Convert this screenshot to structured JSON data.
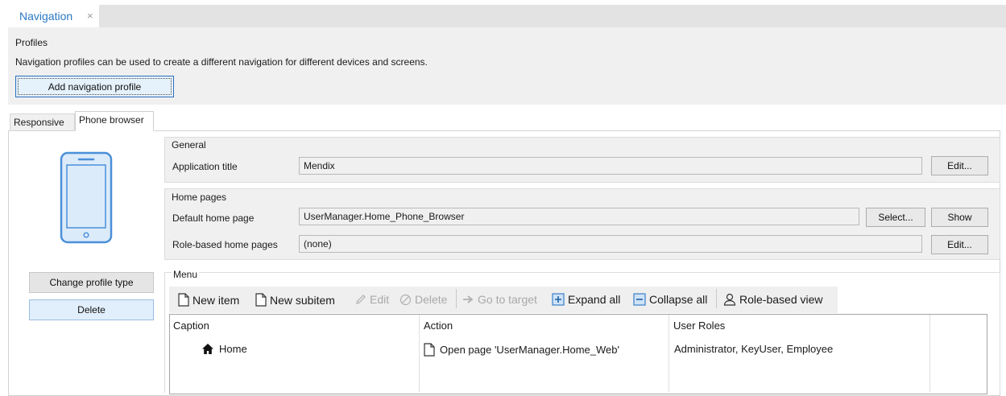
{
  "document_tab": {
    "title": "Navigation",
    "close": "×"
  },
  "profiles": {
    "title": "Profiles",
    "description": "Navigation profiles can be used to create a different navigation for different devices and screens.",
    "add_button": "Add navigation profile"
  },
  "profile_tabs": [
    {
      "label": "Responsive",
      "active": false
    },
    {
      "label": "Phone browser",
      "active": true
    }
  ],
  "left_pane": {
    "icon": "phone-icon",
    "change_type_button": "Change profile type",
    "delete_button": "Delete"
  },
  "general": {
    "title": "General",
    "app_title_label": "Application title",
    "app_title_value": "Mendix",
    "edit_button": "Edit..."
  },
  "home_pages": {
    "title": "Home pages",
    "default_label": "Default home page",
    "default_value": "UserManager.Home_Phone_Browser",
    "select_button": "Select...",
    "show_button": "Show",
    "role_label": "Role-based home pages",
    "role_value": "(none)",
    "edit_button": "Edit..."
  },
  "menu": {
    "title": "Menu",
    "toolbar": {
      "new_item": "New item",
      "new_subitem": "New subitem",
      "edit": "Edit",
      "delete": "Delete",
      "go_to_target": "Go to target",
      "expand_all": "Expand all",
      "collapse_all": "Collapse all",
      "role_based_view": "Role-based view"
    },
    "columns": [
      "Caption",
      "Action",
      "User Roles"
    ],
    "rows": [
      {
        "caption": "Home",
        "caption_icon": "home-icon",
        "action": "Open page 'UserManager.Home_Web'",
        "action_icon": "page-icon",
        "roles": "Administrator, KeyUser, Employee"
      }
    ]
  },
  "colors": {
    "accent": "#2a78c5",
    "selected_button_bg": "#e5f1fb",
    "panel_bg": "#f0f0f0"
  }
}
